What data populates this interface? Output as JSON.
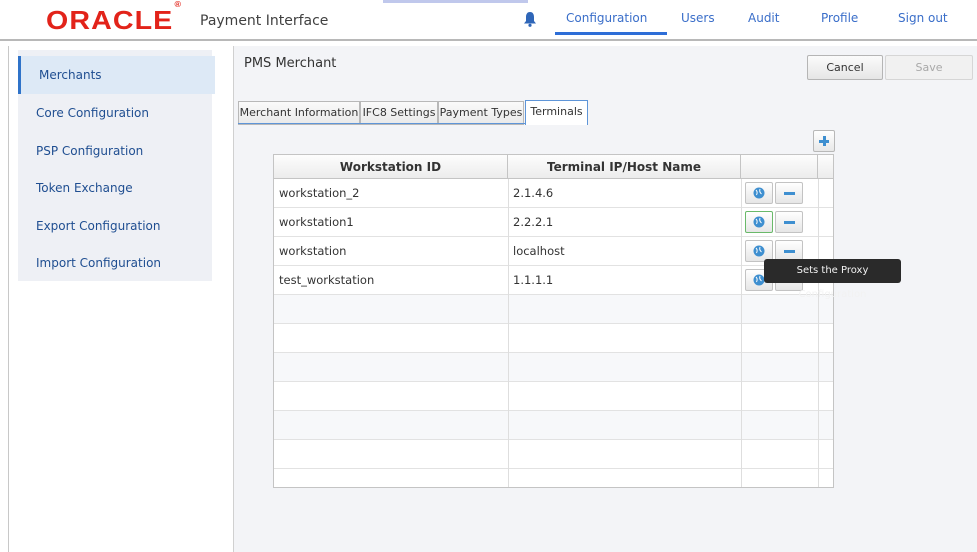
{
  "header": {
    "logo_text": "ORACLE",
    "logo_mark": "®",
    "app_title": "Payment Interface",
    "bell_icon": "bell-icon",
    "nav": [
      "Configuration",
      "Users",
      "Audit",
      "Profile",
      "Sign out"
    ],
    "active_nav": "Configuration"
  },
  "sidebar": {
    "items": [
      {
        "label": "Merchants",
        "active": true
      },
      {
        "label": "Core Configuration"
      },
      {
        "label": "PSP Configuration"
      },
      {
        "label": "Token Exchange"
      },
      {
        "label": "Export Configuration"
      },
      {
        "label": "Import Configuration"
      }
    ]
  },
  "main": {
    "title": "PMS Merchant",
    "cancel_label": "Cancel",
    "save_label": "Save",
    "tabs": [
      "Merchant Information",
      "IFC8 Settings",
      "Payment Types",
      "Terminals"
    ],
    "active_tab": "Terminals",
    "add_icon": "plus-icon"
  },
  "table": {
    "columns": [
      "Workstation ID",
      "Terminal IP/Host Name",
      ""
    ],
    "rows": [
      {
        "workstation": "workstation_2",
        "host": "2.1.4.6"
      },
      {
        "workstation": "workstation1",
        "host": "2.2.2.1"
      },
      {
        "workstation": "workstation",
        "host": "localhost"
      },
      {
        "workstation": "test_workstation",
        "host": "1.1.1.1"
      }
    ],
    "row_action_icons": [
      "globe-icon",
      "minus-icon"
    ]
  },
  "tooltip": {
    "text": "Sets the Proxy Configuration"
  },
  "colors": {
    "brand_red": "#e2231a",
    "link_blue": "#3a6ec9",
    "accent_blue": "#2e6ed7"
  }
}
